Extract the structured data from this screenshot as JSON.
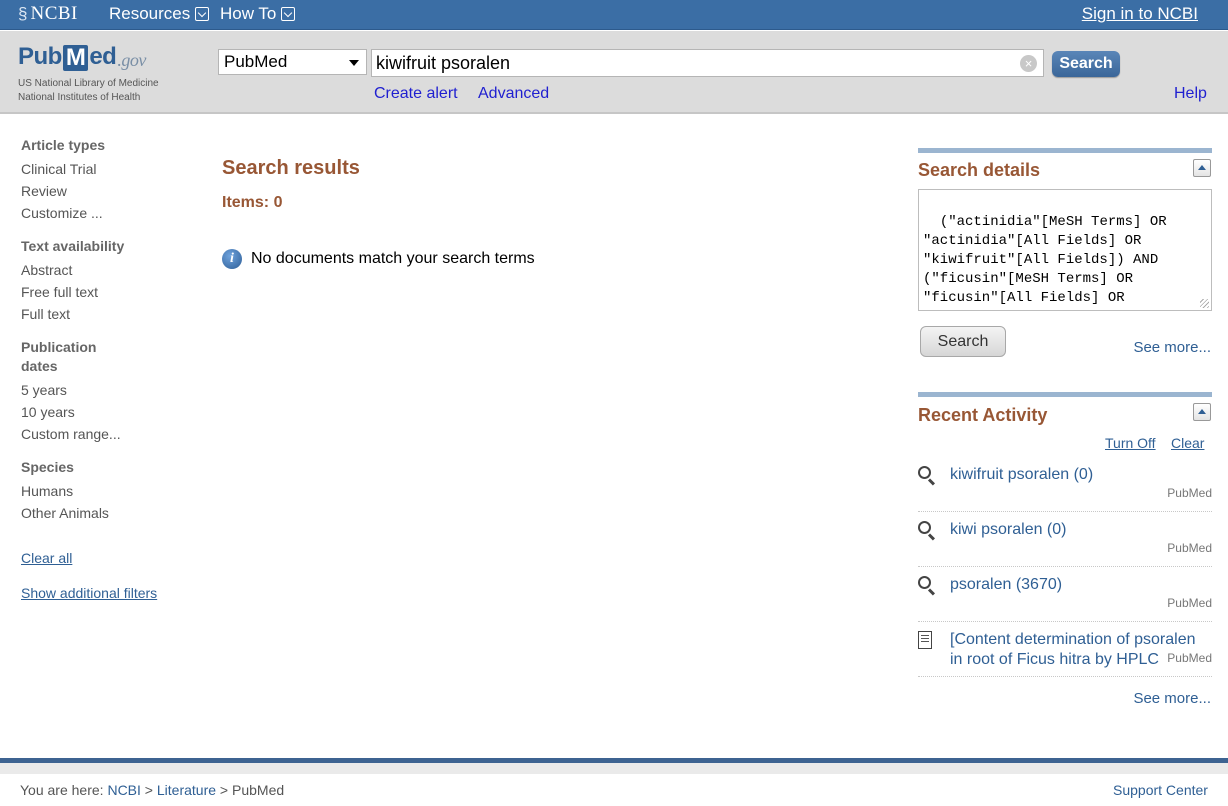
{
  "topbar": {
    "logo": "NCBI",
    "menu_resources": "Resources",
    "menu_howto": "How To",
    "signin": "Sign in to NCBI"
  },
  "header": {
    "logo_pub": "Pub",
    "logo_m": "M",
    "logo_ed": "ed",
    "logo_gov": ".gov",
    "logo_line1": "US National Library of Medicine",
    "logo_line2": "National Institutes of Health",
    "database": "PubMed",
    "query": "kiwifruit psoralen",
    "search_button": "Search",
    "create_alert": "Create alert",
    "advanced": "Advanced",
    "help": "Help"
  },
  "filters": {
    "groups": [
      {
        "title": "Article types",
        "items": [
          "Clinical Trial",
          "Review",
          "Customize ..."
        ]
      },
      {
        "title": "Text availability",
        "items": [
          "Abstract",
          "Free full text",
          "Full text"
        ]
      },
      {
        "title": "Publication dates",
        "items": [
          "5 years",
          "10 years",
          "Custom range..."
        ]
      },
      {
        "title": "Species",
        "items": [
          "Humans",
          "Other Animals"
        ]
      }
    ],
    "clear_all": "Clear all",
    "show_additional": "Show additional filters"
  },
  "results": {
    "title": "Search results",
    "items": "Items: 0",
    "message": "No documents match your search terms"
  },
  "search_details": {
    "title": "Search details",
    "query": "(\"actinidia\"[MeSH Terms] OR\n\"actinidia\"[All Fields] OR\n\"kiwifruit\"[All Fields]) AND\n(\"ficusin\"[MeSH Terms] OR\n\"ficusin\"[All Fields] OR\n\"psoralen\"[All Fields])",
    "search_button": "Search",
    "see_more": "See more..."
  },
  "recent_activity": {
    "title": "Recent Activity",
    "turn_off": "Turn Off",
    "clear": "Clear",
    "items": [
      {
        "text": "kiwifruit psoralen (0)",
        "source": "PubMed",
        "icon": "magnifier-icon"
      },
      {
        "text": "kiwi psoralen (0)",
        "source": "PubMed",
        "icon": "magnifier-icon"
      },
      {
        "text": "psoralen (3670)",
        "source": "PubMed",
        "icon": "magnifier-icon"
      },
      {
        "text_line1": "[Content determination of psoralen",
        "text_line2": "in root of Ficus hitra by HPLC",
        "source": "PubMed",
        "icon": "document-icon"
      }
    ],
    "see_more": "See more..."
  },
  "footer": {
    "you_are_here": "You are here:",
    "crumb_ncbi": "NCBI",
    "crumb_literature": "Literature",
    "crumb_pubmed": "PubMed",
    "sep": ">",
    "support": "Support Center"
  }
}
